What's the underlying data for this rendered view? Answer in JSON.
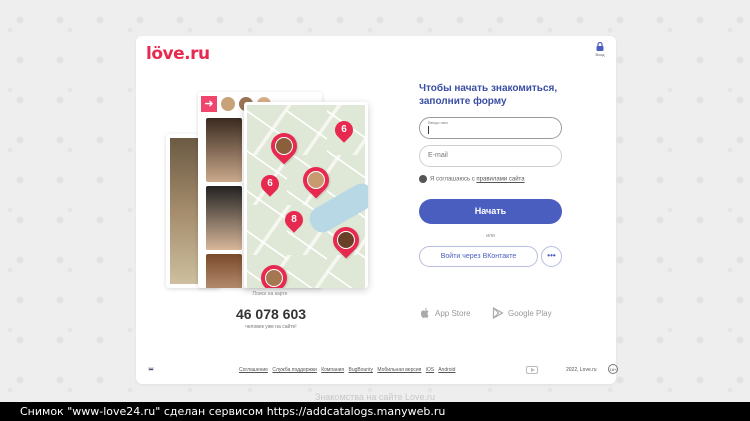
{
  "brand": {
    "logo": "löve.ru",
    "accent": "#e8294f",
    "primary": "#4a5ec0"
  },
  "header": {
    "login_label": "Вход",
    "login_icon": "lock-icon"
  },
  "illustration": {
    "map_caption": "Поиск на карте",
    "pin_counts": [
      "6",
      "6",
      "8"
    ],
    "member_count": "46 078 603",
    "member_caption": "человек уже на сайте!"
  },
  "form": {
    "title": "Чтобы начать знакомиться, заполните форму",
    "name_field_label": "Введи имя",
    "email_placeholder": "E-mail",
    "agree_text": "Я соглашаюсь с",
    "agree_link": "правилами сайта",
    "start_button": "Начать",
    "or_label": "или",
    "vk_button": "Войти через ВКонтакте",
    "more_button": "•••"
  },
  "stores": {
    "app_store": "App Store",
    "google_play": "Google Play"
  },
  "footer": {
    "links": [
      "Соглашение",
      "Служба поддержки",
      "Компания",
      "BugBounty",
      "Мобильная версия",
      "iOS",
      "Android"
    ],
    "copyright": "2022, Love.ru",
    "age_badge": "18+"
  },
  "below_card_text": "Знакомства на сайте Love.ru",
  "caption_strip": "Снимок \"www-love24.ru\" сделан сервисом https://addcatalogs.manyweb.ru"
}
